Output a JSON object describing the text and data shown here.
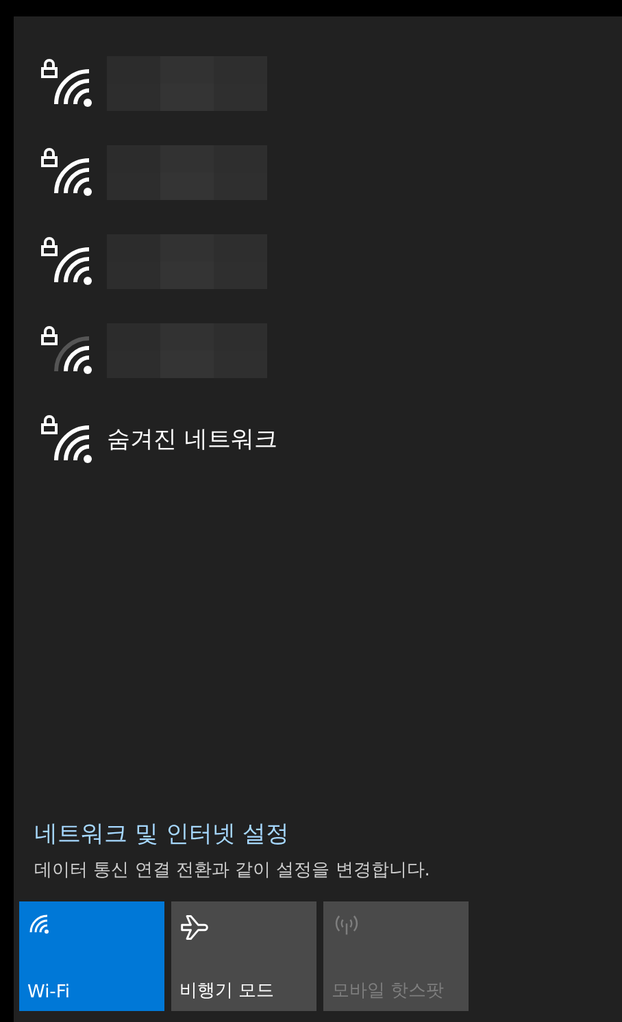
{
  "networks": [
    {
      "kind": "redacted",
      "secured": true,
      "weak_signal": false
    },
    {
      "kind": "redacted",
      "secured": true,
      "weak_signal": false
    },
    {
      "kind": "redacted",
      "secured": true,
      "weak_signal": false
    },
    {
      "kind": "redacted",
      "secured": true,
      "weak_signal": true
    },
    {
      "kind": "named",
      "name": "숨겨진 네트워크",
      "secured": true,
      "weak_signal": false
    }
  ],
  "settings_link": "네트워크 및 인터넷 설정",
  "settings_description": "데이터 통신 연결 전환과 같이 설정을 변경합니다.",
  "quick_actions": [
    {
      "kind": "wifi",
      "label": "Wi-Fi",
      "on": true,
      "disabled": false
    },
    {
      "kind": "airplane",
      "label": "비행기 모드",
      "on": false,
      "disabled": false
    },
    {
      "kind": "hotspot",
      "label": "모바일 핫스팟",
      "on": false,
      "disabled": true
    }
  ]
}
